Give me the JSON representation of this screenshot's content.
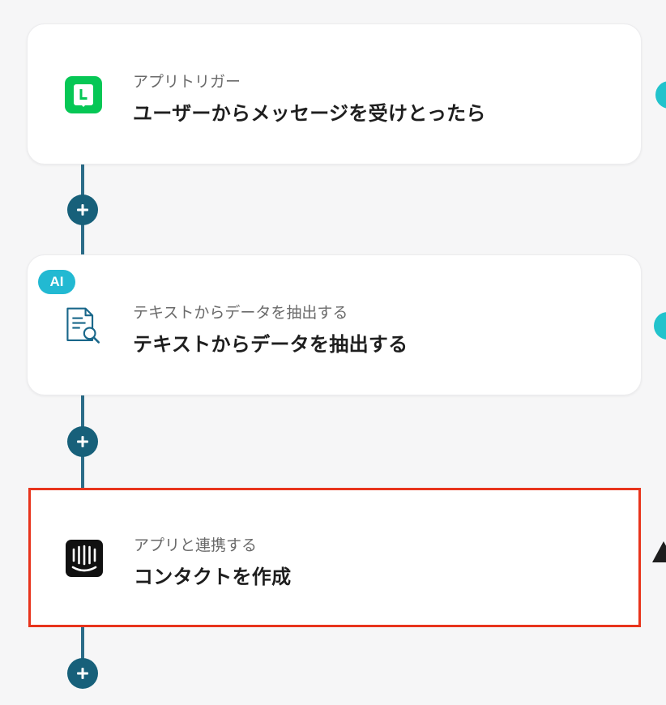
{
  "steps": [
    {
      "label": "アプリトリガー",
      "title": "ユーザーからメッセージを受けとったら",
      "icon": "line-app-icon"
    },
    {
      "label": "テキストからデータを抽出する",
      "title": "テキストからデータを抽出する",
      "icon": "document-search-icon",
      "badge": "AI"
    },
    {
      "label": "アプリと連携する",
      "title": "コンタクトを作成",
      "icon": "intercom-app-icon"
    }
  ],
  "colors": {
    "connector": "#2b6c88",
    "add_button": "#17607a",
    "selected_border": "#e8341c",
    "ai_badge": "#22b9d2",
    "line_green": "#06c755"
  },
  "add_buttons": [
    "plus-icon",
    "plus-icon",
    "plus-icon"
  ]
}
